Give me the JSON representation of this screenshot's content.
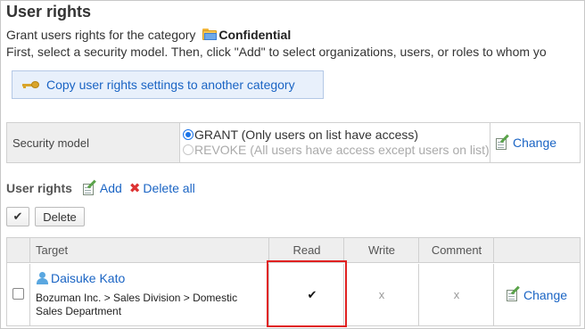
{
  "page": {
    "title": "User rights",
    "intro_prefix": "Grant users rights for the category",
    "category_name": "Confidential",
    "instruction": "First, select a security model. Then, click \"Add\" to select organizations, users, or roles to whom yo"
  },
  "copy_button": {
    "label": "Copy user rights settings to another category"
  },
  "security_model": {
    "label": "Security model",
    "options": [
      {
        "label": "GRANT (Only users on list have access)",
        "selected": true
      },
      {
        "label": "REVOKE (All users have access except users on list)",
        "selected": false
      }
    ],
    "change_label": "Change"
  },
  "user_rights": {
    "heading": "User rights",
    "add_label": "Add",
    "delete_all_label": "Delete all",
    "check_glyph": "✔",
    "delete_label": "Delete",
    "columns": {
      "target": "Target",
      "read": "Read",
      "write": "Write",
      "comment": "Comment"
    },
    "rows": [
      {
        "name": "Daisuke Kato",
        "org": "Bozuman Inc. > Sales Division > Domestic Sales Department",
        "read": "✔",
        "write": "x",
        "comment": "x",
        "change_label": "Change"
      }
    ]
  },
  "colors": {
    "link": "#1a64c4",
    "highlight": "#e02020",
    "header_bg": "#eeeeee"
  }
}
